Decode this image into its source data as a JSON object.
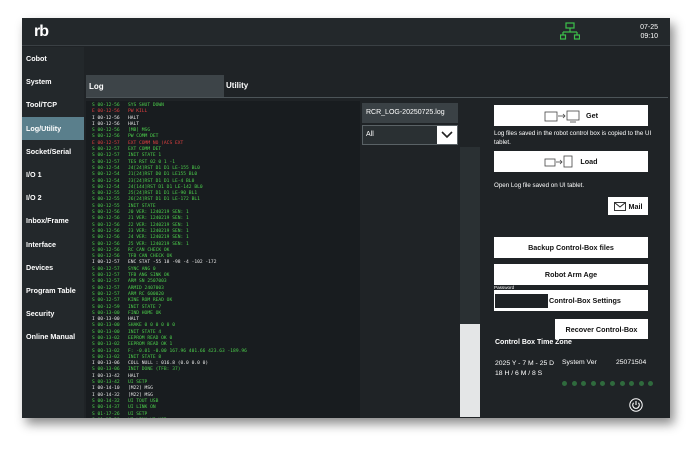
{
  "app": {
    "logo": "rb"
  },
  "header": {
    "date": "07-25",
    "time": "09:10",
    "network_icon": "network-icon"
  },
  "sidebar": {
    "items": [
      {
        "label": "Cobot",
        "active": false
      },
      {
        "label": "System",
        "active": false
      },
      {
        "label": "Tool/TCP",
        "active": false
      },
      {
        "label": "Log/Utility",
        "active": true
      },
      {
        "label": "Socket/Serial",
        "active": false
      },
      {
        "label": "I/O 1",
        "active": false
      },
      {
        "label": "I/O 2",
        "active": false
      },
      {
        "label": "Inbox/Frame",
        "active": false
      },
      {
        "label": "Interface",
        "active": false
      },
      {
        "label": "Devices",
        "active": false
      },
      {
        "label": "Program Table",
        "active": false
      },
      {
        "label": "Security",
        "active": false
      },
      {
        "label": "Online Manual",
        "active": false
      }
    ]
  },
  "tabs": {
    "log": "Log",
    "utility": "Utility"
  },
  "log": {
    "file_name": "RCR_LOG-20250725.log",
    "filter": "All",
    "lines": [
      {
        "c": "g",
        "t": "S 00-12-56   SYS SHUT DOWN"
      },
      {
        "c": "r",
        "t": "E 00-12-56   PW KILL"
      },
      {
        "c": "w",
        "t": "I 00-12-56   HALT"
      },
      {
        "c": "w",
        "t": "I 00-12-56   HALT"
      },
      {
        "c": "g",
        "t": "S 00-12-56   [MB] MSG"
      },
      {
        "c": "g",
        "t": "S 00-12-56   PW COMM DET"
      },
      {
        "c": "r",
        "t": "E 00-12-57   EXT COMM NO (ACS EXT"
      },
      {
        "c": "g",
        "t": "S 00-12-57   EXT COMM DET"
      },
      {
        "c": "g",
        "t": "S 00-12-57   INIT STATE 1"
      },
      {
        "c": "g",
        "t": "S 00-12-57   TES RST 02 0 1 -1"
      },
      {
        "c": "g",
        "t": "S 00-12-54   J4[24]RST D1 D1 LE-155 BL0"
      },
      {
        "c": "g",
        "t": "S 00-12-54   J1[24]RST D0 D1 LE155 BL0"
      },
      {
        "c": "g",
        "t": "S 00-12-54   J3[24]RST D1 D1 LE-4 BL0"
      },
      {
        "c": "g",
        "t": "S 00-12-54   J4[144]RST D1 D1 LE-142 BL0"
      },
      {
        "c": "g",
        "t": "S 00-12-55   J5[24]RST D1 D1 LE-90 BL1"
      },
      {
        "c": "g",
        "t": "S 00-12-55   J6[24]RST D1 D1 LE-172 BL1"
      },
      {
        "c": "g",
        "t": "S 00-12-55   INIT STATE"
      },
      {
        "c": "g",
        "t": "S 00-12-56   J0 VER: 1240219 SEN: 1"
      },
      {
        "c": "g",
        "t": "S 00-12-56   J1 VER: 1240219 SEN: 1"
      },
      {
        "c": "g",
        "t": "S 00-12-56   J2 VER: 1240219 SEN: 1"
      },
      {
        "c": "g",
        "t": "S 00-12-56   J3 VER: 1240219 SEN: 1"
      },
      {
        "c": "g",
        "t": "S 00-12-56   J4 VER: 1240219 SEN: 1"
      },
      {
        "c": "g",
        "t": "S 00-12-56   J5 VER: 1240219 SEN: 1"
      },
      {
        "c": "g",
        "t": "S 00-12-56   RC CAN CHECK OK"
      },
      {
        "c": "g",
        "t": "S 00-12-56   TFB CAN CHECK OK"
      },
      {
        "c": "w",
        "t": "I 00-12-57   ENC STAT -55 18 -98 -4 -102 -172"
      },
      {
        "c": "g",
        "t": "S 00-12-57   SYNC ANG 0"
      },
      {
        "c": "g",
        "t": "S 00-12-57   TFB ANG SINK OK"
      },
      {
        "c": "g",
        "t": "S 00-12-57   ARM SN 2507003"
      },
      {
        "c": "g",
        "t": "S 00-12-57   ARMID 2407003"
      },
      {
        "c": "g",
        "t": "S 00-12-57   ARM RC 600020"
      },
      {
        "c": "g",
        "t": "S 00-12-57   KINE ROM READ OK"
      },
      {
        "c": "g",
        "t": "S 00-12-59   INIT STATE 7"
      },
      {
        "c": "g",
        "t": "S 00-13-00   FIND HOME OK"
      },
      {
        "c": "w",
        "t": "I 00-13-00   HALT"
      },
      {
        "c": "g",
        "t": "S 00-13-00   SHAKE 0 0 0 0 0 0"
      },
      {
        "c": "g",
        "t": "S 00-13-00   INIT STATE 4"
      },
      {
        "c": "g",
        "t": "S 00-13-02   EEPROM READ OK 0"
      },
      {
        "c": "g",
        "t": "S 00-13-02   EEPROM READ OK 1"
      },
      {
        "c": "g",
        "t": "S 00-13-02   F: -0.01 -0.00 167.96 401.66 423.63 -189.96"
      },
      {
        "c": "g",
        "t": "S 00-13-02   INIT STATE 8"
      },
      {
        "c": "w",
        "t": "I 00-13-06   COLL NULL : 016.8 (0.0 0.0 0)"
      },
      {
        "c": "g",
        "t": "S 00-13-06   INIT DONE (TFB: 37)"
      },
      {
        "c": "w",
        "t": "I 00-13-42   HALT"
      },
      {
        "c": "g",
        "t": "S 00-13-42   UI SETP"
      },
      {
        "c": "w",
        "t": "I 00-14-10   [M22] MSG"
      },
      {
        "c": "w",
        "t": "I 00-14-32   [M22] MSG"
      },
      {
        "c": "g",
        "t": "S 00-14-32   UI TOUT USB"
      },
      {
        "c": "g",
        "t": "S 00-14-37   UI LINK ON"
      },
      {
        "c": "g",
        "t": "S 01-17-26   UI SETP"
      },
      {
        "c": "g",
        "t": "S 01-17-28   UI LINK UP USB"
      },
      {
        "c": "g",
        "t": "S 01-32-22   UI TOUT USB"
      },
      {
        "c": "g",
        "t": "S 01-32-22   UI LINK ON"
      },
      {
        "c": "g",
        "t": "S 01-33-28   UI SETP"
      },
      {
        "c": "g",
        "t": "S 18-05-08   UI RAKE"
      },
      {
        "c": "g",
        "t": "S 18-05-08   UI LINK UP USB"
      },
      {
        "c": "w",
        "t": "I 18-05-08   HALT"
      },
      {
        "c": "g",
        "t": "S 18-05-09   UI SETP"
      },
      {
        "c": "g",
        "t": "S 18-05-10   GET LOG VIA USB"
      }
    ]
  },
  "utility": {
    "get_label": "Get",
    "get_note": "Log files saved in the robot control box is copied to the UI tablet.",
    "load_label": "Load",
    "load_note": "Open Log file saved on UI tablet.",
    "mail_label": "Mail",
    "backup_files_label": "Backup Control-Box files",
    "arm_age_label": "Robot Arm Age",
    "backup_settings_label": "Backup Control-Box Settings",
    "password_label": "Password",
    "password_value": "",
    "recover_label": "Recover Control-Box"
  },
  "timezone": {
    "title": "Control Box Time Zone",
    "date": "2025 Y - 7 M - 25 D",
    "time": "18 H / 6 M / 8 S",
    "system_ver_label": "System Ver",
    "system_ver_value": "25071504"
  },
  "colors": {
    "accent": "#5a7f8c",
    "log_green": "#4ccf4c",
    "log_red": "#e04040",
    "dot_green": "#2f6a3d"
  }
}
